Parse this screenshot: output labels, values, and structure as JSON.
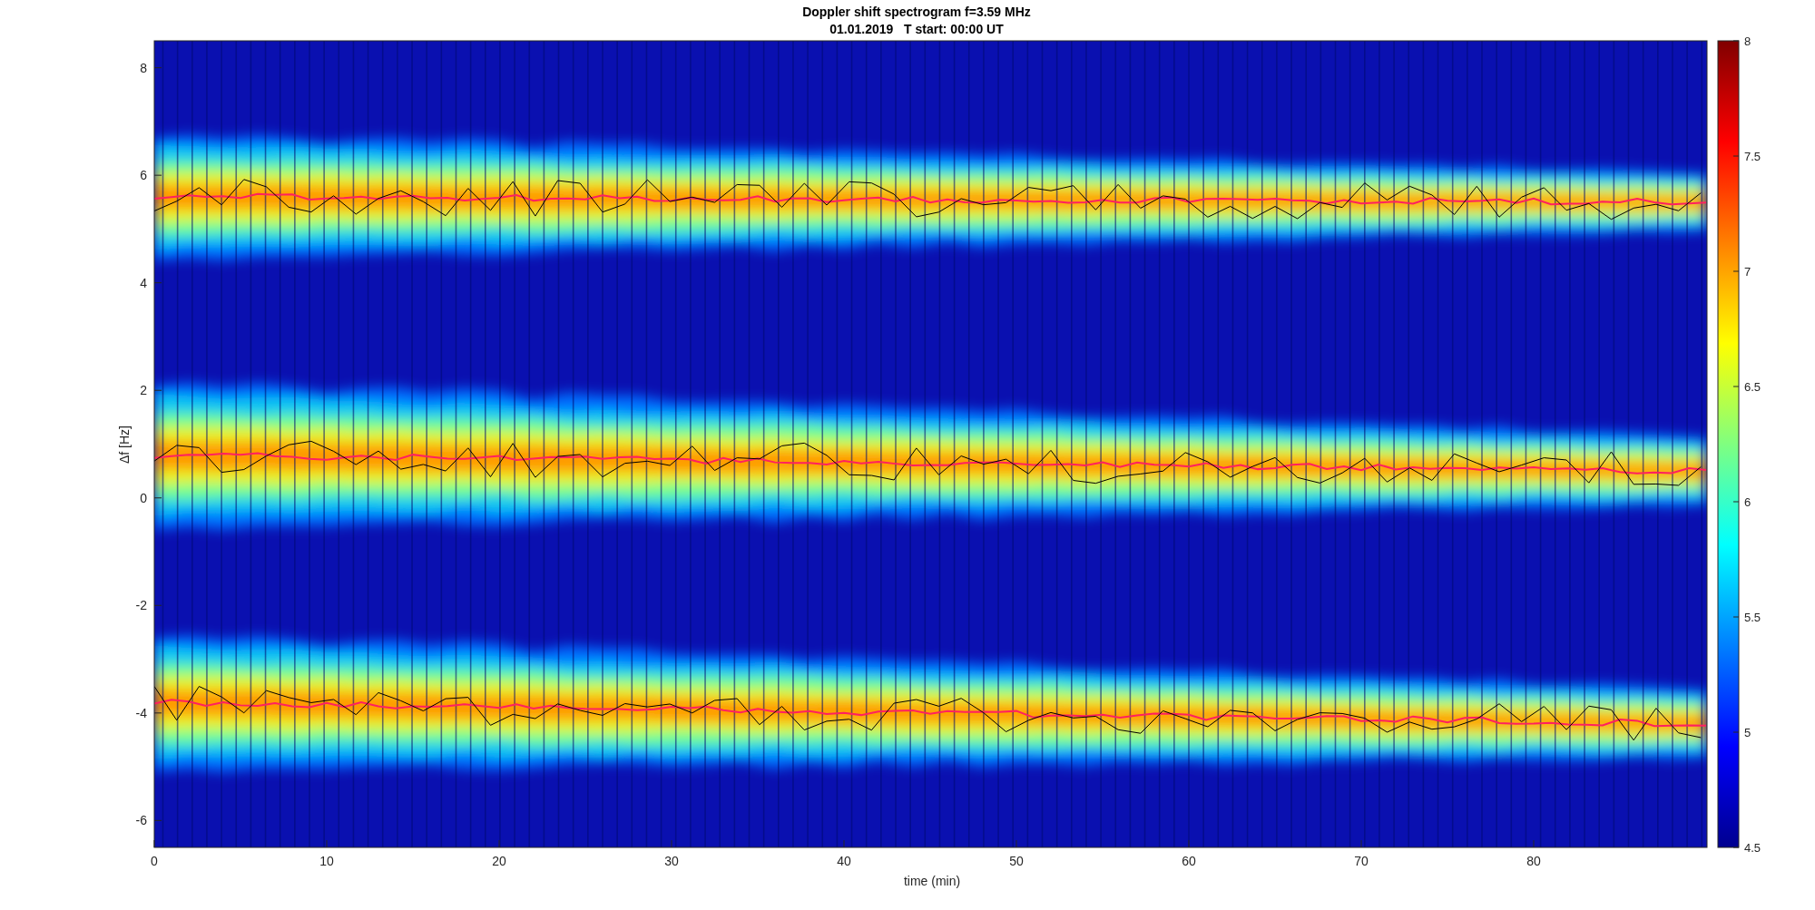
{
  "title": "Doppler shift spectrogram f=3.59 MHz",
  "subtitle": "01.01.2019   T start: 00:00 UT",
  "y_axis": {
    "label": "Δf [Hz]",
    "ticks": [
      "8",
      "6",
      "4",
      "2",
      "0",
      "-2",
      "-4",
      "-6"
    ]
  },
  "x_axis": {
    "label": "time (min)",
    "ticks": [
      "0",
      "10",
      "20",
      "30",
      "40",
      "50",
      "60",
      "70",
      "80"
    ]
  },
  "colorbar": {
    "ticks": [
      "8",
      "7.5",
      "7",
      "6.5",
      "6",
      "5.5",
      "5",
      "4.5"
    ]
  }
}
